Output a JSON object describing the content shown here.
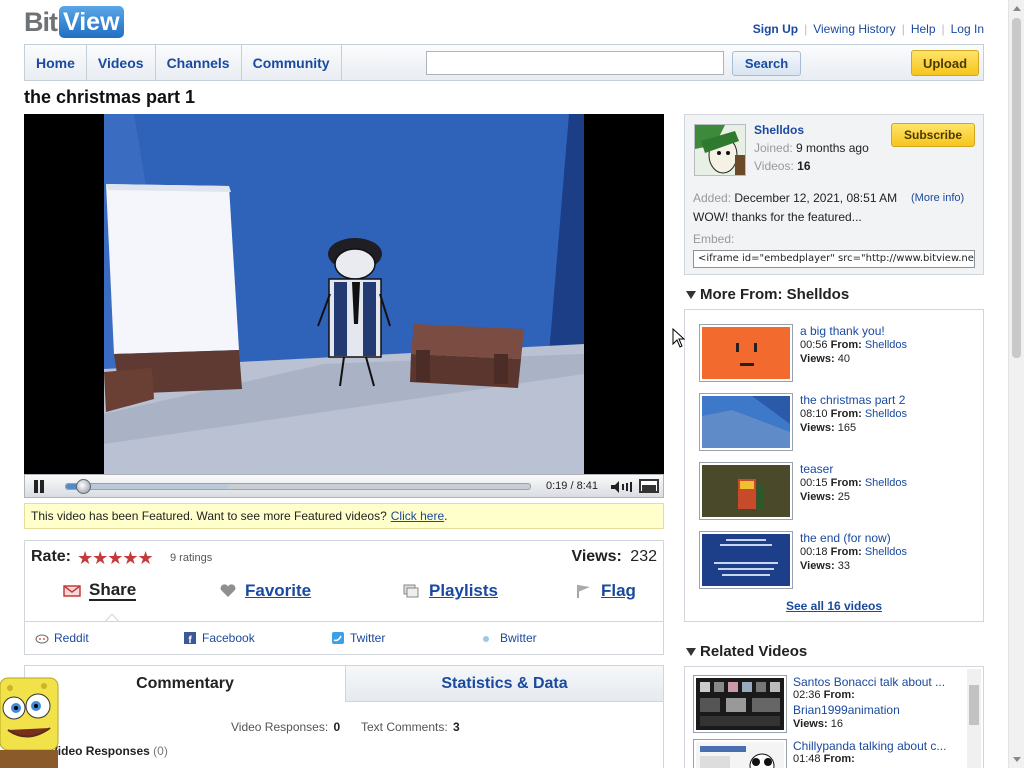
{
  "header": {
    "logo_left": "Bit",
    "logo_right": "View",
    "links": {
      "signup": "Sign Up",
      "history": "Viewing History",
      "help": "Help",
      "login": "Log In"
    }
  },
  "nav": {
    "tabs": [
      "Home",
      "Videos",
      "Channels",
      "Community"
    ],
    "search_value": "",
    "search_label": "Search",
    "upload_label": "Upload"
  },
  "video": {
    "title": "the christmas part 1",
    "time": "0:19 / 8:41",
    "progress_fraction": 0.037,
    "buffered_fraction": 0.35
  },
  "featured": {
    "text": "This video has been Featured. Want to see more Featured videos?",
    "link": "Click here",
    "after": "."
  },
  "rating": {
    "label": "Rate:",
    "stars": "★★★★★",
    "count": "9 ratings",
    "value": 4.5,
    "views_label": "Views:",
    "views": "232"
  },
  "actions": {
    "share": "Share",
    "favorite": "Favorite",
    "playlists": "Playlists",
    "flag": "Flag"
  },
  "social": {
    "reddit": "Reddit",
    "facebook": "Facebook",
    "twitter": "Twitter",
    "bwitter": "Bwitter"
  },
  "tabs": {
    "commentary": "Commentary",
    "stats": "Statistics & Data",
    "vr_label": "Video Responses:",
    "vr_count": "0",
    "tc_label": "Text Comments:",
    "tc_count": "3",
    "vr_title": "Video Responses",
    "vr_title_count": "(0)"
  },
  "channel": {
    "name": "Shelldos",
    "joined_label": "Joined:",
    "joined": "9 months ago",
    "videos_label": "Videos:",
    "videos": "16",
    "subscribe": "Subscribe",
    "added_label": "Added:",
    "added": "December 12, 2021, 08:51 AM",
    "more_info": "(More info)",
    "description": "WOW! thanks for the featured...",
    "embed_label": "Embed:",
    "embed_code": "<iframe id=\"embedplayer\" src=\"http://www.bitview.net/embed.php"
  },
  "more_from": {
    "heading": "More From: Shelldos",
    "from_label": "From:",
    "views_label": "Views:",
    "items": [
      {
        "title": "a big thank you!",
        "duration": "00:56",
        "author": "Shelldos",
        "views": "40"
      },
      {
        "title": "the christmas part 2",
        "duration": "08:10",
        "author": "Shelldos",
        "views": "165"
      },
      {
        "title": "teaser",
        "duration": "00:15",
        "author": "Shelldos",
        "views": "25"
      },
      {
        "title": "the end (for now)",
        "duration": "00:18",
        "author": "Shelldos",
        "views": "33"
      }
    ],
    "see_all": "See all 16 videos"
  },
  "related": {
    "heading": "Related Videos",
    "items": [
      {
        "title": "Santos Bonacci talk about ...",
        "duration": "02:36",
        "from_label": "From:",
        "author": "Brian1999animation",
        "views_label": "Views:",
        "views": "16"
      },
      {
        "title": "Chillypanda talking about c...",
        "duration": "01:48",
        "from_label": "From:"
      }
    ]
  },
  "colors": {
    "link": "#1a4aa0",
    "accent_yellow": "#f7c51c",
    "star": "#c53b3b",
    "featured_bg": "#ffffcc"
  }
}
